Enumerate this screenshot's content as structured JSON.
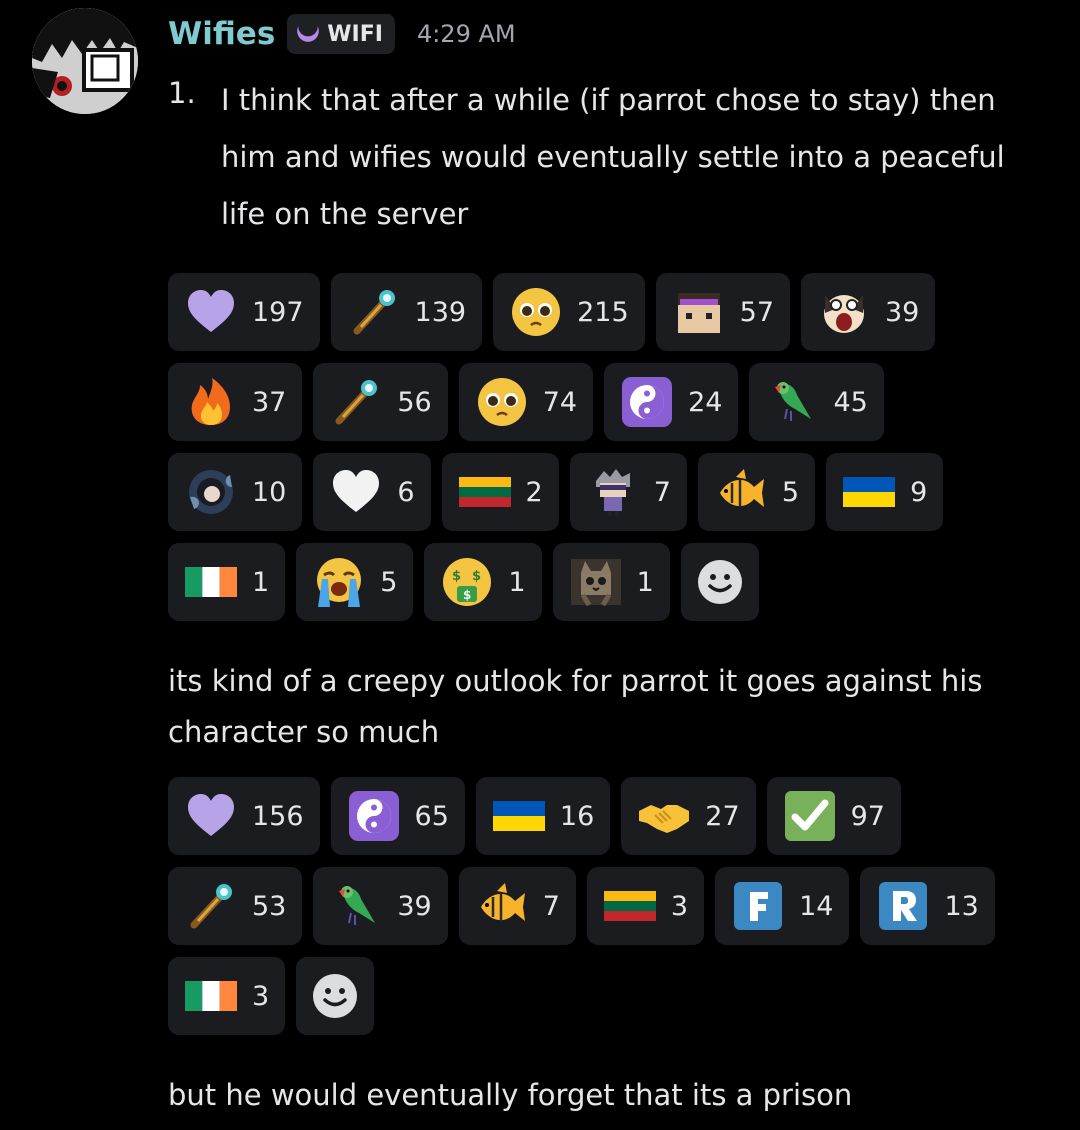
{
  "message": {
    "username": "Wifies",
    "tag": "WIFI",
    "timestamp": "4:29 AM",
    "list_number": "1.",
    "paragraph1": "I think that after a while (if parrot chose to stay) then him and wifies would eventually settle into a peaceful life on the server",
    "paragraph2": "its kind of a creepy outlook for parrot it goes against his character so much",
    "paragraph3": "but he would eventually forget that its a prison"
  },
  "reactions_block1": {
    "rows": [
      [
        {
          "icon": "purple-heart-icon",
          "count": "197"
        },
        {
          "icon": "golden-staff-icon",
          "count": "139"
        },
        {
          "icon": "pleading-face-icon",
          "count": "215"
        },
        {
          "icon": "pixel-character-icon",
          "count": "57"
        },
        {
          "icon": "screaming-dog-icon",
          "count": "39"
        }
      ],
      [
        {
          "icon": "fire-icon",
          "count": "37"
        },
        {
          "icon": "golden-staff-icon",
          "count": "56"
        },
        {
          "icon": "pleading-face-icon",
          "count": "74"
        },
        {
          "icon": "yin-yang-icon",
          "count": "24"
        },
        {
          "icon": "parrot-icon",
          "count": "45"
        }
      ],
      [
        {
          "icon": "anime-character-icon",
          "count": "10"
        },
        {
          "icon": "white-heart-icon",
          "count": "6"
        },
        {
          "icon": "lithuania-flag-icon",
          "count": "2"
        },
        {
          "icon": "chibi-character-icon",
          "count": "7"
        },
        {
          "icon": "tropical-fish-icon",
          "count": "5"
        },
        {
          "icon": "ukraine-flag-icon",
          "count": "9"
        }
      ],
      [
        {
          "icon": "ireland-flag-icon",
          "count": "1"
        },
        {
          "icon": "loudly-crying-face-icon",
          "count": "5"
        },
        {
          "icon": "money-mouth-face-icon",
          "count": "1"
        },
        {
          "icon": "cat-icon",
          "count": "1"
        }
      ]
    ]
  },
  "reactions_block2": {
    "rows": [
      [
        {
          "icon": "purple-heart-icon",
          "count": "156"
        },
        {
          "icon": "yin-yang-icon",
          "count": "65"
        },
        {
          "icon": "ukraine-flag-icon",
          "count": "16"
        },
        {
          "icon": "handshake-icon",
          "count": "27"
        },
        {
          "icon": "check-mark-icon",
          "count": "97"
        }
      ],
      [
        {
          "icon": "golden-staff-icon",
          "count": "53"
        },
        {
          "icon": "parrot-icon",
          "count": "39"
        },
        {
          "icon": "tropical-fish-icon",
          "count": "7"
        },
        {
          "icon": "lithuania-flag-icon",
          "count": "3"
        },
        {
          "icon": "regional-f-icon",
          "count": "14"
        },
        {
          "icon": "regional-r-icon",
          "count": "13"
        }
      ],
      [
        {
          "icon": "ireland-flag-icon",
          "count": "3"
        }
      ]
    ]
  },
  "colors": {
    "background": "#000000",
    "username": "#7fcbd0",
    "reaction_bg": "#1b1c1f",
    "text": "#e6e6e8",
    "timestamp": "#a4a6ad"
  }
}
